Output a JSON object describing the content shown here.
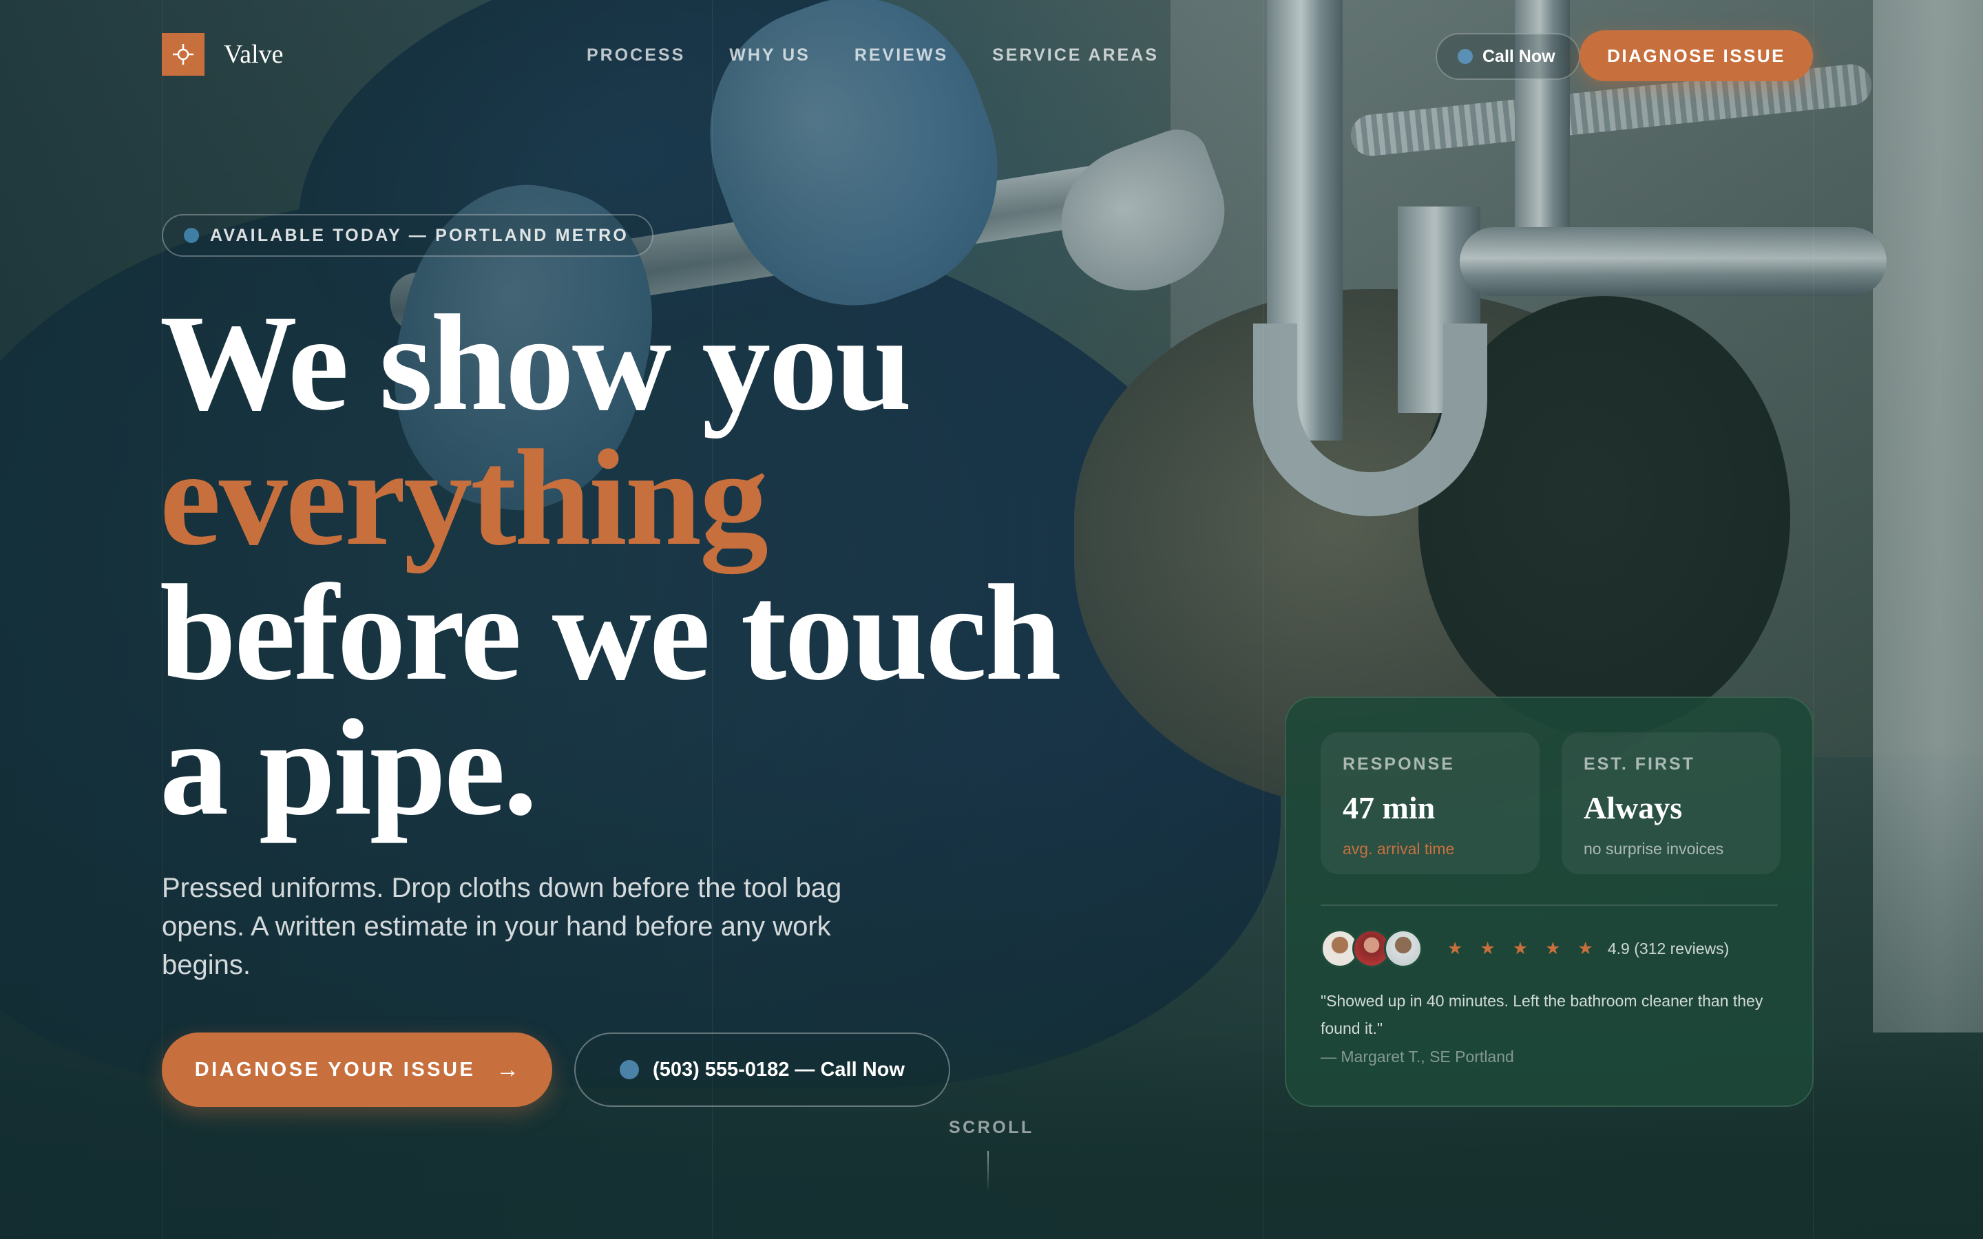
{
  "brand": {
    "name": "Valve",
    "mark_icon": "crosshair-icon",
    "accent": "#c8703d"
  },
  "nav": {
    "links": [
      "PROCESS",
      "WHY US",
      "REVIEWS",
      "SERVICE AREAS"
    ],
    "call_label": "Call Now",
    "diagnose_label": "DIAGNOSE ISSUE"
  },
  "hero": {
    "badge": "AVAILABLE TODAY — PORTLAND METRO",
    "headline": {
      "line1": "We show you",
      "line2": "everything",
      "line3": "before we touch",
      "line4": "a pipe."
    },
    "subcopy": "Pressed uniforms. Drop cloths down before the tool bag opens. A written estimate in your hand before any work begins.",
    "cta_primary": "DIAGNOSE YOUR ISSUE",
    "cta_primary_icon": "arrow-right-icon",
    "cta_secondary": "(503) 555-0182 — Call Now",
    "scroll": "SCROLL"
  },
  "card": {
    "stats": [
      {
        "label": "RESPONSE",
        "value": "47 min",
        "note": "avg. arrival time"
      },
      {
        "label": "EST. FIRST",
        "value": "Always",
        "note": "no surprise invoices"
      }
    ],
    "stars": "★ ★ ★ ★ ★",
    "rating": "4.9 (312 reviews)",
    "quote": "\"Showed up in 40 minutes. Left the bathroom cleaner than they found it.\"",
    "author": "— Margaret T., SE Portland"
  },
  "colors": {
    "accent": "#c8703d",
    "card_bg": "#1c4838",
    "status_dot": "#5b8fb3"
  }
}
